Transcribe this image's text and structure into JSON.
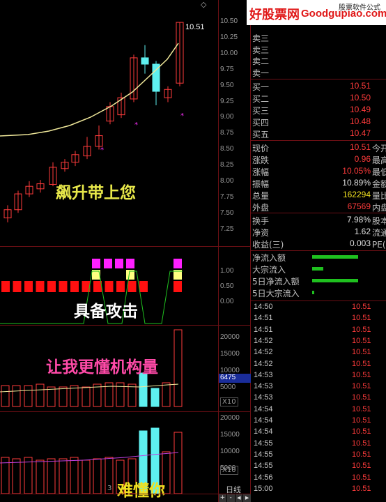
{
  "watermark": {
    "site": "好股票网",
    "domain": "Goodgupiao.com",
    "tag": "股票软件公式"
  },
  "top_right_icon": "◇",
  "price_chart": {
    "last_price_label": "10.51",
    "axis_labels": [
      "10.50",
      "10.25",
      "10.00",
      "9.75",
      "9.50",
      "9.25",
      "9.00",
      "8.75",
      "8.50",
      "8.25",
      "8.00",
      "7.75",
      "7.50",
      "7.25"
    ],
    "caption": "飙升带上您"
  },
  "signal_chart": {
    "axis_labels": [
      "1.00",
      "0.50",
      "0.00"
    ],
    "caption": "具备攻击"
  },
  "volume_chart": {
    "axis_labels": [
      "20000",
      "15000",
      "10000",
      "5000"
    ],
    "highlight_value": "6475",
    "unit": "X10",
    "caption": "让我更懂机构量"
  },
  "money_chart": {
    "axis_labels": [
      "20000",
      "15000",
      "10000",
      "5000"
    ],
    "unit": "X10",
    "caption": "难懂你",
    "bottom_marker": "3"
  },
  "period_label": "日线",
  "nav_buttons": [
    "+",
    "-",
    "◀",
    "▶"
  ],
  "order_book": {
    "sell": [
      {
        "label": "卖三",
        "value": ""
      },
      {
        "label": "卖二",
        "value": ""
      },
      {
        "label": "卖一",
        "value": ""
      }
    ],
    "buy": [
      {
        "label": "买一",
        "value": "10.51"
      },
      {
        "label": "买二",
        "value": "10.50"
      },
      {
        "label": "买三",
        "value": "10.49"
      },
      {
        "label": "买四",
        "value": "10.48"
      },
      {
        "label": "买五",
        "value": "10.47"
      }
    ]
  },
  "quote": [
    {
      "label": "现价",
      "value": "10.51",
      "extra": "今开",
      "color": "#ff3b3b"
    },
    {
      "label": "涨跌",
      "value": "0.96",
      "extra": "最高",
      "color": "#ff3b3b"
    },
    {
      "label": "涨幅",
      "value": "10.05%",
      "extra": "最低",
      "color": "#ff3b3b"
    },
    {
      "label": "振幅",
      "value": "10.89%",
      "extra": "金额",
      "color": "#e0e0e0"
    },
    {
      "label": "总量",
      "value": "162294",
      "extra": "量比",
      "color": "#f0e020"
    },
    {
      "label": "外盘",
      "value": "67569",
      "extra": "内盘",
      "color": "#ff3b3b"
    }
  ],
  "fundamentals": [
    {
      "label": "换手",
      "value": "7.98%",
      "extra": "股本",
      "color": "#e0e0e0"
    },
    {
      "label": "净资",
      "value": "1.62",
      "extra": "流通",
      "color": "#e0e0e0"
    },
    {
      "label": "收益(三)",
      "value": "0.003",
      "extra": "PE(动)",
      "color": "#e0e0e0"
    }
  ],
  "money_flow": [
    {
      "label": "净流入额",
      "level": 0.55
    },
    {
      "label": "大宗流入",
      "level": 0.13
    },
    {
      "label": "5日净流入额",
      "level": 0.55
    },
    {
      "label": "5日大宗流入",
      "level": 0.02
    }
  ],
  "ticks": [
    {
      "time": "14:50",
      "price": "10.51"
    },
    {
      "time": "14:51",
      "price": "10.51"
    },
    {
      "time": "14:51",
      "price": "10.51"
    },
    {
      "time": "14:52",
      "price": "10.51"
    },
    {
      "time": "14:52",
      "price": "10.51"
    },
    {
      "time": "14:52",
      "price": "10.51"
    },
    {
      "time": "14:53",
      "price": "10.51"
    },
    {
      "time": "14:53",
      "price": "10.51"
    },
    {
      "time": "14:53",
      "price": "10.51"
    },
    {
      "time": "14:54",
      "price": "10.51"
    },
    {
      "time": "14:54",
      "price": "10.51"
    },
    {
      "time": "14:54",
      "price": "10.51"
    },
    {
      "time": "14:55",
      "price": "10.51"
    },
    {
      "time": "14:55",
      "price": "10.51"
    },
    {
      "time": "14:55",
      "price": "10.51"
    },
    {
      "time": "14:56",
      "price": "10.51"
    },
    {
      "time": "15:00",
      "price": "10.51"
    }
  ],
  "colors": {
    "up": "#ff3b3b",
    "down": "#5ef0f0",
    "ma": "#f0e89a",
    "signal_red": "#ff1010",
    "signal_magenta": "#ff20ff",
    "signal_yellow": "#ffff80",
    "flow_green": "#1fc01f"
  }
}
